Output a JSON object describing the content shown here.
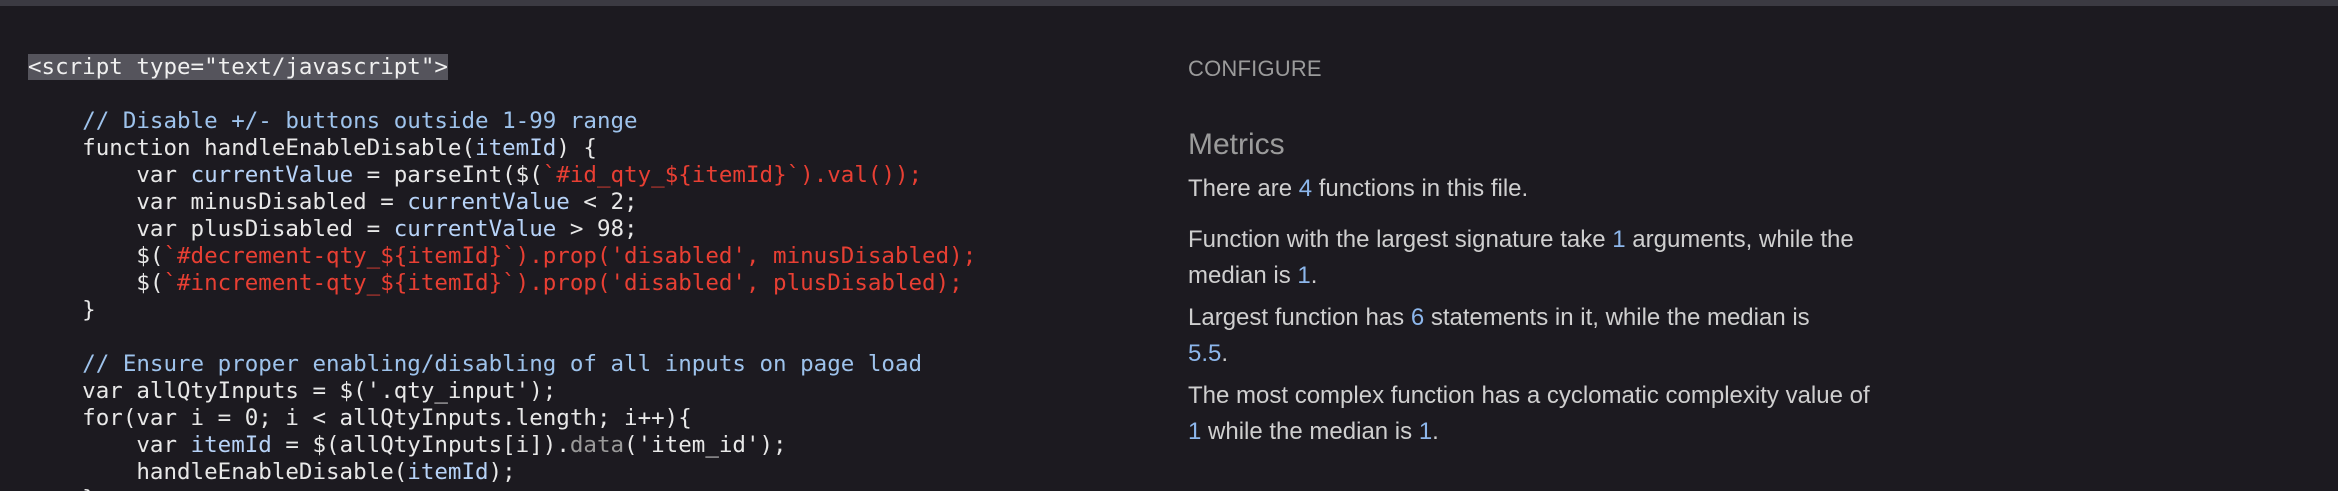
{
  "code": {
    "lines": [
      [
        {
          "t": "<script type=\"text/javascript\">",
          "c": "tag-hl"
        }
      ],
      [],
      [
        {
          "t": "    "
        },
        {
          "t": "// Disable +/- buttons outside 1-99 range",
          "c": "tok-comment"
        }
      ],
      [
        {
          "t": "    function handleEnableDisable("
        },
        {
          "t": "itemId",
          "c": "tok-var"
        },
        {
          "t": ") {"
        }
      ],
      [
        {
          "t": "        var "
        },
        {
          "t": "currentValue",
          "c": "tok-var"
        },
        {
          "t": " = parseInt($("
        },
        {
          "t": "`#id_qty_${itemId}`",
          "c": "tok-tpl"
        },
        {
          "t": ").val());",
          "c": "tok-tpl"
        }
      ],
      [
        {
          "t": "        var minusDisabled = "
        },
        {
          "t": "currentValue",
          "c": "tok-var"
        },
        {
          "t": " < 2;"
        }
      ],
      [
        {
          "t": "        var plusDisabled = "
        },
        {
          "t": "currentValue",
          "c": "tok-var"
        },
        {
          "t": " > 98;"
        }
      ],
      [
        {
          "t": "        $("
        },
        {
          "t": "`#decrement-qty_${itemId}`).prop('disabled', minusDisabled);",
          "c": "tok-tpl"
        }
      ],
      [
        {
          "t": "        $("
        },
        {
          "t": "`#increment-qty_${itemId}`).prop('disabled', plusDisabled);",
          "c": "tok-tpl"
        }
      ],
      [
        {
          "t": "    }"
        }
      ],
      [],
      [
        {
          "t": "    "
        },
        {
          "t": "// Ensure proper enabling/disabling of all inputs on page load",
          "c": "tok-comment"
        }
      ],
      [
        {
          "t": "    var allQtyInputs = $('.qty_input');"
        }
      ],
      [
        {
          "t": "    for(var i = 0; i < allQtyInputs.length; i++){"
        }
      ],
      [
        {
          "t": "        var "
        },
        {
          "t": "itemId",
          "c": "tok-var"
        },
        {
          "t": " = $(allQtyInputs[i])."
        },
        {
          "t": "data",
          "c": "tok-method"
        },
        {
          "t": "('item_id');"
        }
      ],
      [
        {
          "t": "        handleEnableDisable("
        },
        {
          "t": "itemId",
          "c": "tok-var"
        },
        {
          "t": ");"
        }
      ],
      [
        {
          "t": "    }"
        }
      ]
    ]
  },
  "configure": {
    "label": "CONFIGURE",
    "heading": "Metrics",
    "metrics": {
      "functions": {
        "pre": "There are ",
        "value": "4",
        "post": " functions in this file."
      },
      "signature": {
        "pre": "Function with the largest signature take ",
        "value": "1",
        "mid": " arguments, while the median is ",
        "median": "1",
        "post": "."
      },
      "statements": {
        "pre": "Largest function has ",
        "value": "6",
        "mid": " statements in it, while the median is ",
        "median": "5.5",
        "post": "."
      },
      "complexity": {
        "pre": "The most complex function has a cyclomatic complexity value of ",
        "value": "1",
        "mid": " while the median is ",
        "median": "1",
        "post": "."
      }
    }
  }
}
